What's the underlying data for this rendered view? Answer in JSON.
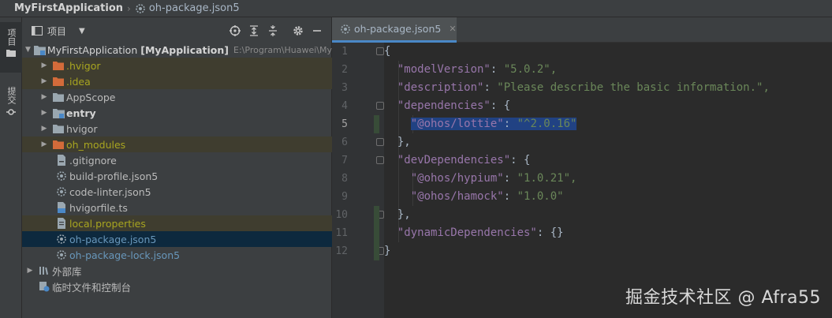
{
  "breadcrumb": {
    "project": "MyFirstApplication",
    "file": "oh-package.json5"
  },
  "side_strip": {
    "project_tab": "项目",
    "commit_tab": "提交"
  },
  "panel": {
    "title": "项目"
  },
  "tree": {
    "root": {
      "name": "MyFirstApplication",
      "module": "[MyApplication]",
      "path": "E:\\Program\\Huawei\\My"
    },
    "items": [
      {
        "label": ".hvigor"
      },
      {
        "label": ".idea"
      },
      {
        "label": "AppScope"
      },
      {
        "label": "entry"
      },
      {
        "label": "hvigor"
      },
      {
        "label": "oh_modules"
      },
      {
        "label": ".gitignore"
      },
      {
        "label": "build-profile.json5"
      },
      {
        "label": "code-linter.json5"
      },
      {
        "label": "hvigorfile.ts"
      },
      {
        "label": "local.properties"
      },
      {
        "label": "oh-package.json5"
      },
      {
        "label": "oh-package-lock.json5"
      }
    ],
    "external": "外部库",
    "scratches": "临时文件和控制台"
  },
  "editor": {
    "tab": "oh-package.json5",
    "line_numbers": [
      "1",
      "2",
      "3",
      "4",
      "5",
      "6",
      "7",
      "8",
      "9",
      "10",
      "11",
      "12"
    ],
    "lines": [
      [
        "{",
        "",
        "",
        ""
      ],
      [
        "  ",
        "\"modelVersion\"",
        ": ",
        "\"5.0.2\","
      ],
      [
        "  ",
        "\"description\"",
        ": ",
        "\"Please describe the basic information.\","
      ],
      [
        "  ",
        "\"dependencies\"",
        ": ",
        "{"
      ],
      [
        "    ",
        "\"@ohos/lottie\"",
        ": ",
        "\"^2.0.16\""
      ],
      [
        "  ",
        "},",
        "",
        ""
      ],
      [
        "  ",
        "\"devDependencies\"",
        ": ",
        "{"
      ],
      [
        "    ",
        "\"@ohos/hypium\"",
        ": ",
        "\"1.0.21\","
      ],
      [
        "    ",
        "\"@ohos/hamock\"",
        ": ",
        "\"1.0.0\""
      ],
      [
        "  ",
        "},",
        "",
        ""
      ],
      [
        "  ",
        "\"dynamicDependencies\"",
        ": ",
        "{}"
      ],
      [
        "}",
        "",
        "",
        ""
      ]
    ]
  },
  "watermark": "掘金技术社区 @ Afra55"
}
